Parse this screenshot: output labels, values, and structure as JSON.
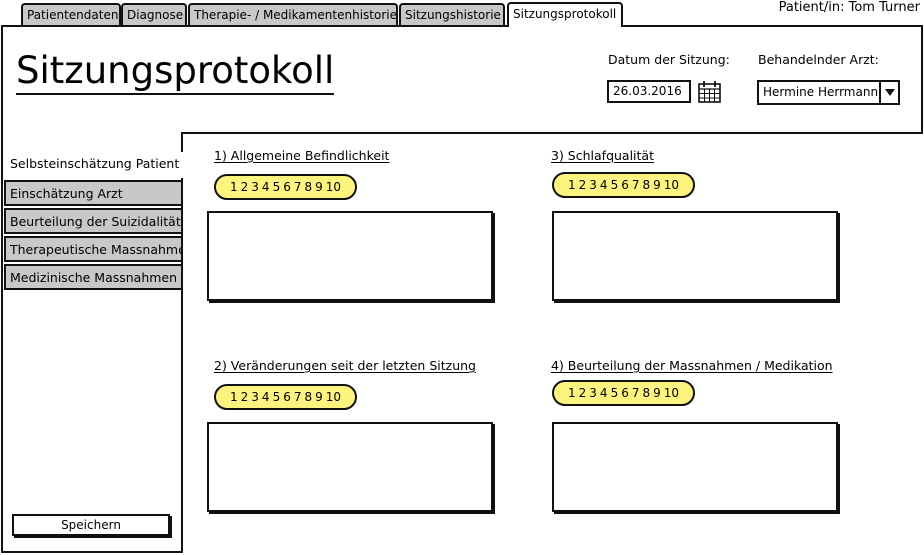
{
  "patient_label": "Patient/in: Tom Turner",
  "tabs": [
    {
      "label": "Patientendaten"
    },
    {
      "label": "Diagnose"
    },
    {
      "label": "Therapie- / Medikamentenhistorie"
    },
    {
      "label": "Sitzungshistorie"
    },
    {
      "label": "Sitzungsprotokoll"
    }
  ],
  "active_tab": "Sitzungsprotokoll",
  "page_title": "Sitzungsprotokoll",
  "session_date": {
    "label": "Datum der Sitzung:",
    "value": "26.03.2016",
    "icon": "calendar-icon"
  },
  "doctor": {
    "label": "Behandelnder Arzt:",
    "value": "Hermine Herrmann",
    "icon": "chevron-down-icon"
  },
  "sidebar": {
    "items": [
      {
        "label": "Selbsteinschätzung Patient"
      },
      {
        "label": "Einschätzung Arzt"
      },
      {
        "label": "Beurteilung der Suizidalität"
      },
      {
        "label": "Therapeutische Massnahmen"
      },
      {
        "label": "Medizinische Massnahmen"
      }
    ],
    "active": "Selbsteinschätzung Patient"
  },
  "sections": [
    {
      "title": "1) Allgemeine Befindlichkeit"
    },
    {
      "title": "3) Schlafqualität"
    },
    {
      "title": "2) Veränderungen seit der letzten Sitzung"
    },
    {
      "title": "4) Beurteilung der Massnahmen / Medikation"
    }
  ],
  "rating_scale": [
    "1",
    "2",
    "3",
    "4",
    "5",
    "6",
    "7",
    "8",
    "9",
    "10"
  ],
  "save_label": "Speichern",
  "colors": {
    "rating_fill": "#fff37f",
    "inactive_tab": "#c8c8c8",
    "stroke": "#111111"
  }
}
